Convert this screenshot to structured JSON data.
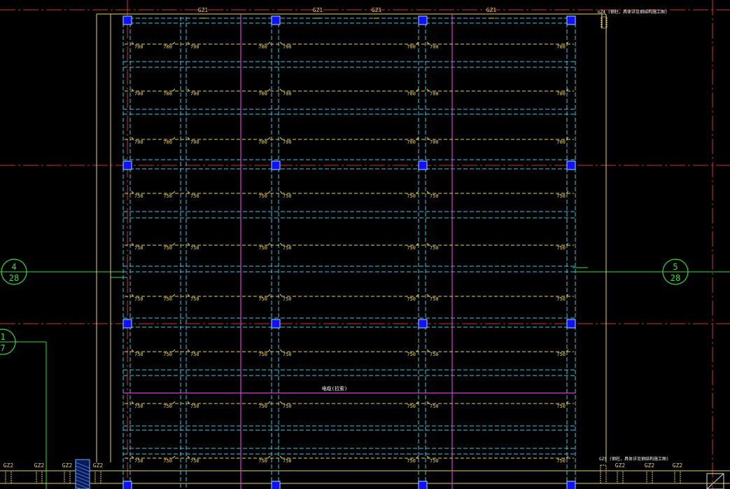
{
  "drawing": {
    "background": "#000000",
    "colors": {
      "axis_line": "#cc3322",
      "wall_outline": "#e8d44d",
      "purlin_dashed": "#35c8e8",
      "tie_dashed": "#e8d44d",
      "magenta_line": "#d040d0",
      "column_fill": "#1010ff",
      "column_edge": "#9fdcff",
      "bubble": "#33dd33",
      "text": "#e8d44d",
      "note_text": "#ffffff"
    },
    "top_column_labels": [
      "GZ1",
      "GZ1",
      "GZ1",
      "GZ1"
    ],
    "top_right_label": "GZ4 (钢柱，具体详见钢结构施工图)",
    "bottom_right_label": "GZ5 (钢柱，具体详见钢结构施工图)",
    "bottom_left_labels": [
      "GZ2",
      "GZ2",
      "GZ2",
      "GZ2"
    ],
    "bottom_right_labels": [
      "GZ2",
      "GZ2",
      "GZ2"
    ],
    "center_note": "电缆(拉索)",
    "upper_dimension": "700",
    "lower_dimension": "750",
    "grid_bubbles": [
      {
        "id": "bubble-4",
        "top": "4",
        "bottom": "28"
      },
      {
        "id": "bubble-5",
        "top": "5",
        "bottom": "28"
      },
      {
        "id": "bubble-1",
        "top": "1",
        "bottom": "7"
      }
    ]
  }
}
